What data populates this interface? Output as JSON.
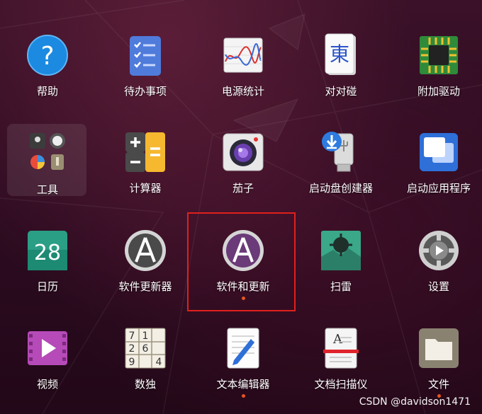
{
  "apps": [
    {
      "label": "帮助",
      "icon": "help-icon",
      "running": false
    },
    {
      "label": "待办事项",
      "icon": "todo-list-icon",
      "running": false
    },
    {
      "label": "电源统计",
      "icon": "power-statistics-icon",
      "running": false
    },
    {
      "label": "对对碰",
      "icon": "mahjongg-icon",
      "running": false
    },
    {
      "label": "附加驱动",
      "icon": "chip-icon",
      "running": false
    },
    {
      "label": "工具",
      "icon": "folder-icon",
      "running": false
    },
    {
      "label": "计算器",
      "icon": "calculator-icon",
      "running": false
    },
    {
      "label": "茄子",
      "icon": "camera-icon",
      "running": false
    },
    {
      "label": "启动盘创建器",
      "icon": "usb-creator-icon",
      "running": false
    },
    {
      "label": "启动应用程序",
      "icon": "startup-apps-icon",
      "running": false
    },
    {
      "label": "日历",
      "icon": "calendar-icon",
      "running": false
    },
    {
      "label": "软件更新器",
      "icon": "software-updater-icon",
      "running": false
    },
    {
      "label": "软件和更新",
      "icon": "software-updates-icon",
      "running": true
    },
    {
      "label": "扫雷",
      "icon": "mines-icon",
      "running": false
    },
    {
      "label": "设置",
      "icon": "settings-icon",
      "running": false
    },
    {
      "label": "视频",
      "icon": "video-icon",
      "running": false
    },
    {
      "label": "数独",
      "icon": "sudoku-icon",
      "running": false
    },
    {
      "label": "文本编辑器",
      "icon": "text-editor-icon",
      "running": true
    },
    {
      "label": "文档扫描仪",
      "icon": "scanner-icon",
      "running": false
    },
    {
      "label": "文件",
      "icon": "files-icon",
      "running": true
    }
  ],
  "calendar_day": "28",
  "mahjongg_char": "東",
  "sudoku_digits": [
    "7",
    "1",
    "2",
    "6",
    "9",
    "4"
  ],
  "watermark": "CSDN @davidson1471",
  "colors": {
    "accent": "#e95420",
    "highlight": "#e0201c"
  }
}
